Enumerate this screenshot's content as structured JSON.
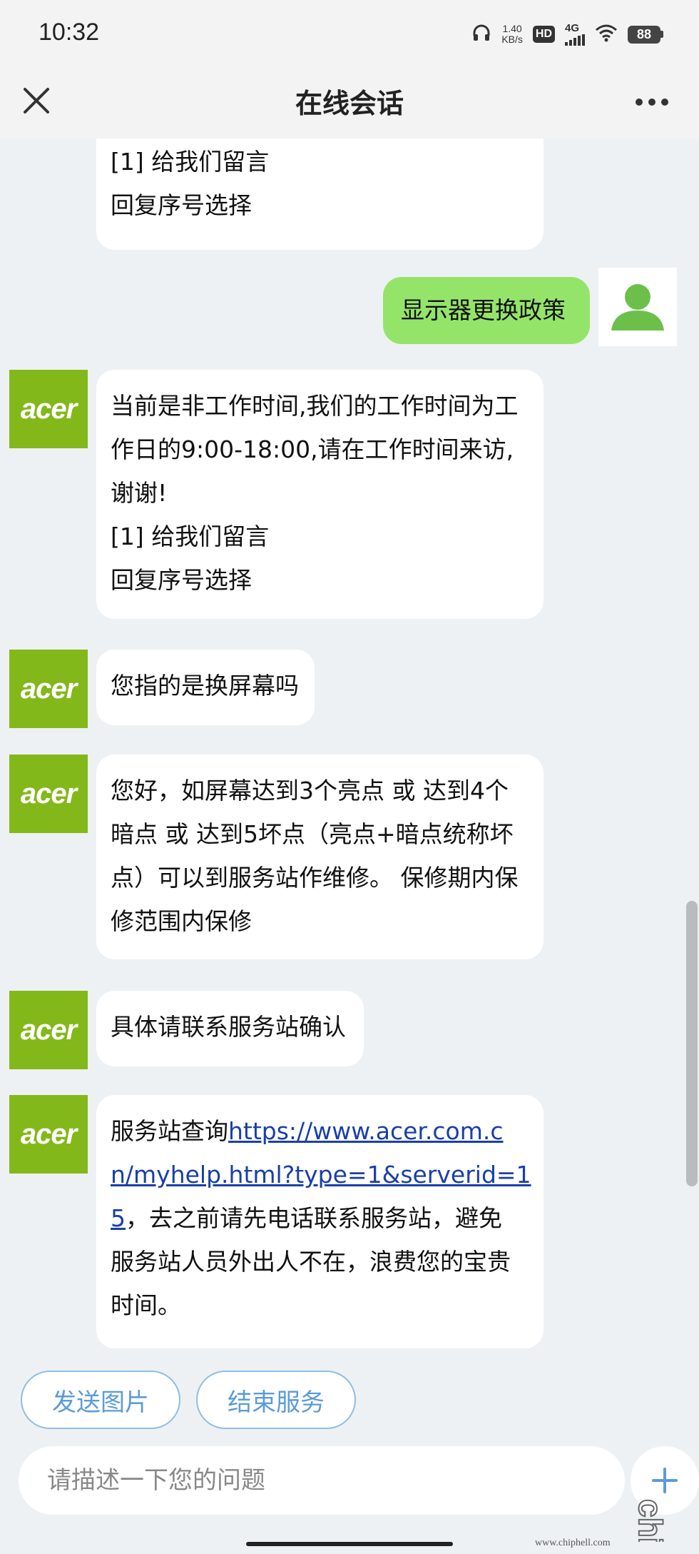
{
  "status_bar": {
    "time": "10:32",
    "speed_value": "1.40",
    "speed_unit": "KB/s",
    "hd": "HD",
    "network": "4G",
    "battery": "88"
  },
  "header": {
    "title": "在线会话",
    "close_icon": "close-icon",
    "more_icon": "more-dots-icon"
  },
  "messages": [
    {
      "from": "bot",
      "text": "[1] 给我们留言\n回复序号选择"
    },
    {
      "from": "user",
      "text": "显示器更换政策"
    },
    {
      "from": "bot",
      "avatar": "acer",
      "text": "当前是非工作时间,我们的工作时间为工\n作日的9:00-18:00,请在工作时间来访,\n谢谢!\n[1] 给我们留言\n回复序号选择"
    },
    {
      "from": "bot",
      "avatar": "acer",
      "text": "您指的是换屏幕吗"
    },
    {
      "from": "bot",
      "avatar": "acer",
      "text": "您好，如屏幕达到3个亮点 或 达到4个\n暗点 或 达到5坏点（亮点+暗点统称坏\n点）可以到服务站作维修。 保修期内保\n修范围内保修"
    },
    {
      "from": "bot",
      "avatar": "acer",
      "text": "具体请联系服务站确认"
    },
    {
      "from": "bot",
      "avatar": "acer",
      "prefix": "服务站查询",
      "link_line1": "https://www.acer.com.c",
      "link_line2": "n/myhelp.html?type=1&serverid=1",
      "link_line3": "5",
      "suffix_line3": "，去之前请先电话联系服务站，避免",
      "suffix_rest": "服务站人员外出人不在，浪费您的宝贵\n时间。"
    }
  ],
  "acer_logo_text": "acer",
  "quick_actions": {
    "send_image": "发送图片",
    "end_service": "结束服务"
  },
  "input": {
    "placeholder": "请描述一下您的问题"
  },
  "watermark": {
    "site": "www.chiphell.com"
  },
  "colors": {
    "acer_green": "#83b81a",
    "user_bubble": "#95e46a",
    "chat_bg": "#eef1f3",
    "link": "#1a3fa8",
    "quick_btn_border": "#8fbde6"
  }
}
